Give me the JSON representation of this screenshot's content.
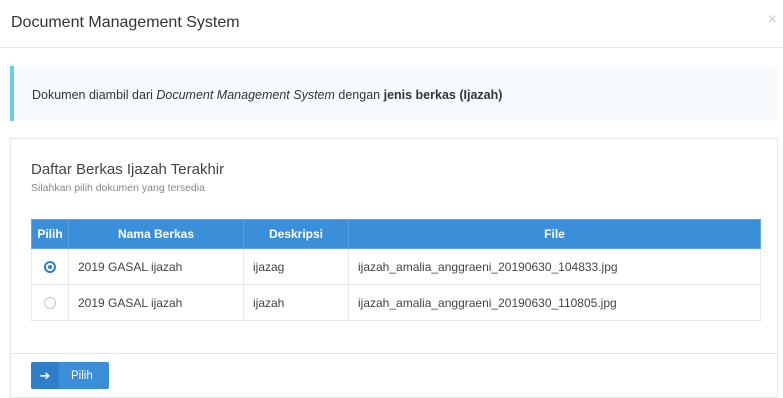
{
  "modal": {
    "title": "Document Management System",
    "close_symbol": "×"
  },
  "info": {
    "prefix": "Dokumen diambil dari ",
    "source": "Document Management System",
    "middle": " dengan ",
    "highlight": "jenis berkas (Ijazah)"
  },
  "card": {
    "title": "Daftar Berkas Ijazah Terakhir",
    "subtitle": "Silahkan pilih dokumen yang tersedia"
  },
  "table": {
    "headers": [
      "Pilih",
      "Nama Berkas",
      "Deskripsi",
      "File"
    ],
    "rows": [
      {
        "selected": true,
        "nama": "2019 GASAL ijazah",
        "deskripsi": "ijazag",
        "file": "ijazah_amalia_anggraeni_20190630_104833.jpg"
      },
      {
        "selected": false,
        "nama": "2019 GASAL ijazah",
        "deskripsi": "ijazah",
        "file": "ijazah_amalia_anggraeni_20190630_110805.jpg"
      }
    ]
  },
  "button": {
    "label": "Pilih",
    "icon": "arrow-right-icon"
  },
  "colors": {
    "primary": "#3b8fd9",
    "info_border": "#6ad0e8"
  }
}
